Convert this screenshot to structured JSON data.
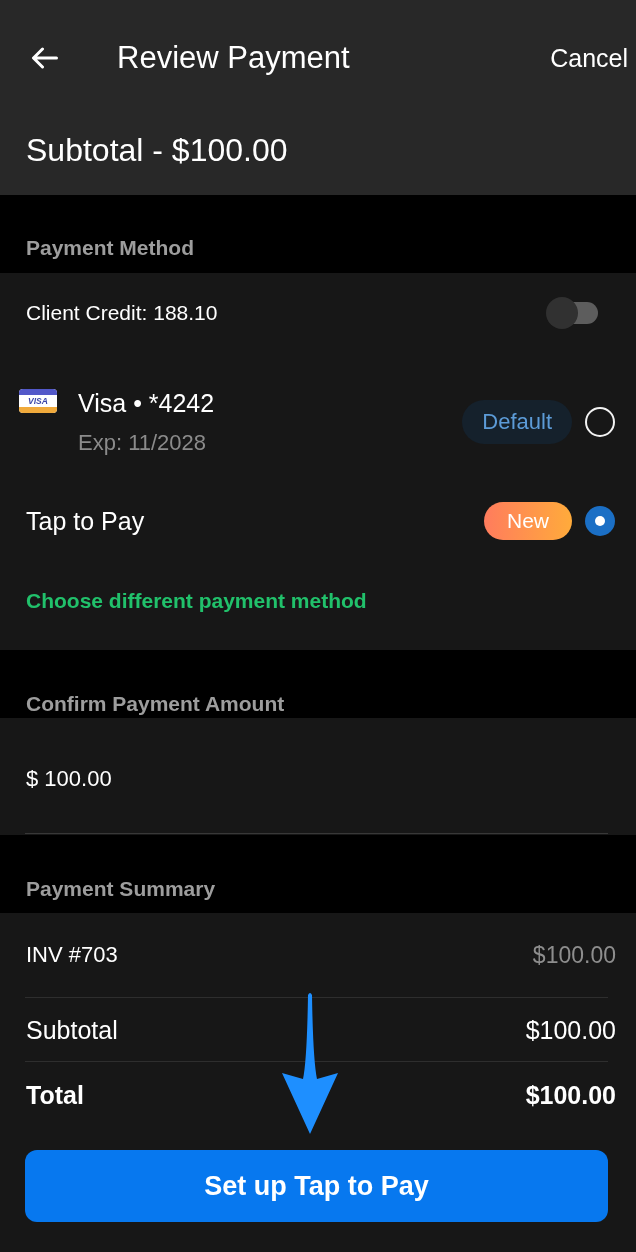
{
  "header": {
    "title": "Review Payment",
    "cancel": "Cancel",
    "subtotal": "Subtotal - $100.00"
  },
  "payment_method": {
    "label": "Payment Method",
    "client_credit": {
      "label": "Client Credit: 188.10",
      "on": false
    },
    "options": [
      {
        "kind": "card",
        "brand_mark": "VISA",
        "name": "Visa • *4242",
        "detail": "Exp: 11/2028",
        "badge": {
          "kind": "default",
          "text": "Default"
        },
        "selected": false
      },
      {
        "kind": "device",
        "name": "Tap to Pay",
        "badge": {
          "kind": "new",
          "text": "New"
        },
        "selected": true
      }
    ],
    "change_link": "Choose different payment method"
  },
  "payment_amount": {
    "label": "Confirm Payment Amount",
    "value": "$ 100.00"
  },
  "payment_summary": {
    "label": "Payment Summary",
    "rows": [
      {
        "kind": "item",
        "label": "INV #703",
        "amount": "$100.00"
      },
      {
        "kind": "subtotal",
        "label": "Subtotal",
        "amount": "$100.00"
      },
      {
        "kind": "total",
        "label": "Total",
        "amount": "$100.00"
      }
    ]
  },
  "action_button": "Set up Tap to Pay"
}
